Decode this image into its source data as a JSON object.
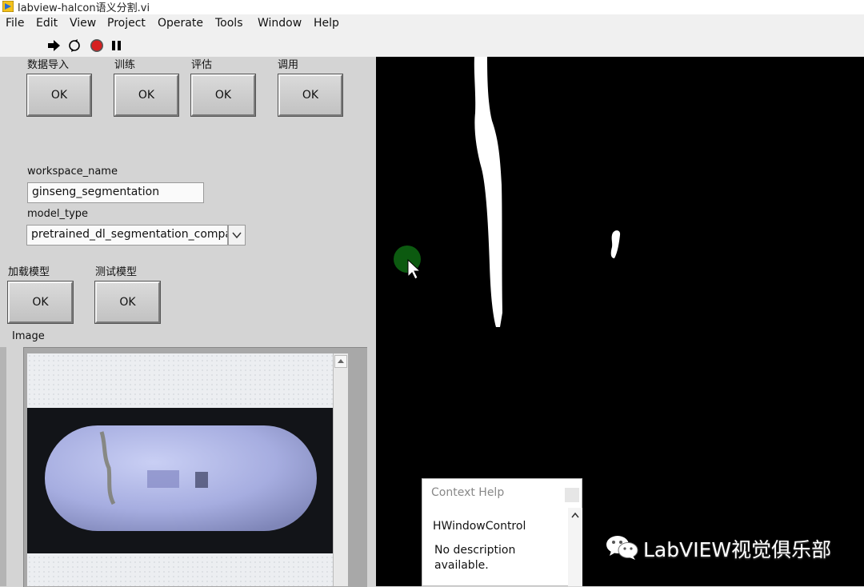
{
  "window": {
    "title": "labview-halcon语义分割.vi"
  },
  "menu": [
    "File",
    "Edit",
    "View",
    "Project",
    "Operate",
    "Tools",
    "Window",
    "Help"
  ],
  "toolbar_icons": [
    "run-arrow-icon",
    "run-continuously-icon",
    "abort-icon",
    "pause-icon"
  ],
  "buttons_top": [
    {
      "label": "数据导入",
      "button": "OK"
    },
    {
      "label": "训练",
      "button": "OK"
    },
    {
      "label": "评估",
      "button": "OK"
    },
    {
      "label": "调用",
      "button": "OK"
    }
  ],
  "workspace": {
    "label": "workspace_name",
    "value": "ginseng_segmentation"
  },
  "model": {
    "label": "model_type",
    "value": "pretrained_dl_segmentation_compac"
  },
  "buttons_mid": [
    {
      "label": "加载模型",
      "button": "OK"
    },
    {
      "label": "测试模型",
      "button": "OK"
    }
  ],
  "image": {
    "label": "Image"
  },
  "context_help": {
    "title": "Context Help",
    "control": "HWindowControl",
    "description": "No description available."
  },
  "watermark": {
    "text": "LabVIEW视觉俱乐部"
  }
}
